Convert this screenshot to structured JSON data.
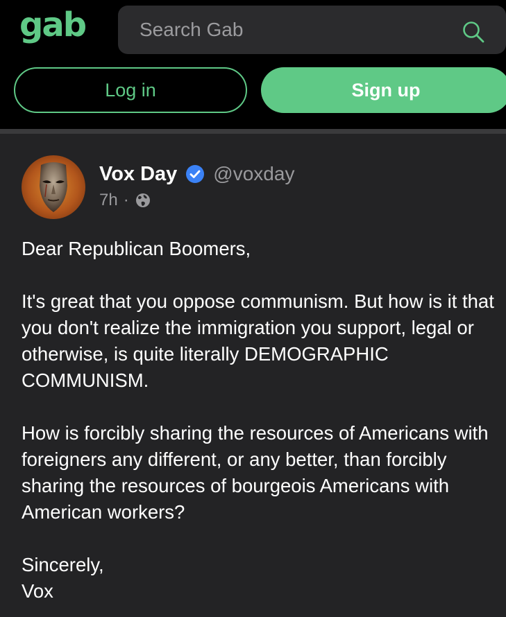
{
  "header": {
    "logo_text": "gab",
    "search_placeholder": "Search Gab",
    "login_label": "Log in",
    "signup_label": "Sign up"
  },
  "colors": {
    "brand_green": "#5fc986",
    "background": "#000000",
    "post_background": "#232325",
    "verified_blue": "#3b82f6"
  },
  "post": {
    "author_name": "Vox Day",
    "handle": "@voxday",
    "time": "7h",
    "separator": "·",
    "visibility_icon": "globe-icon",
    "verified_icon": "verified-badge-icon",
    "body": {
      "greeting": "Dear Republican Boomers,",
      "paragraph1": "It's great that you oppose communism. But how is it that you don't realize the immigration you support, legal or otherwise, is quite literally DEMOGRAPHIC COMMUNISM.",
      "paragraph2": "How is forcibly sharing the resources of Americans with foreigners any different, or any better, than forcibly sharing the resources of bourgeois Americans with American workers?",
      "signoff": "Sincerely,",
      "signature": "Vox"
    }
  }
}
